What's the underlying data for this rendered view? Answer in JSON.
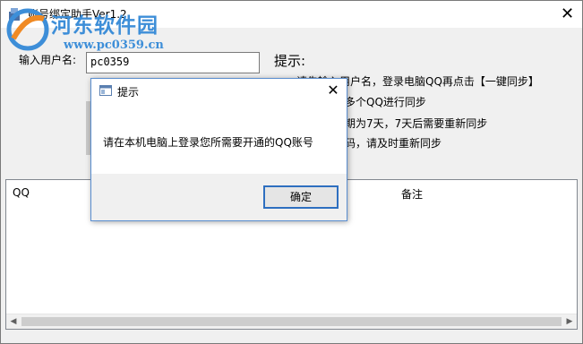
{
  "window": {
    "title": "账号绑定助手Ver1.2",
    "close_glyph": "✕"
  },
  "watermark": {
    "text": "河东软件园",
    "url": "www.pc0359.cn"
  },
  "form": {
    "username_label": "输入用户名:",
    "username_value": "pc0359"
  },
  "tips": {
    "title": "提示:",
    "line1": "请先输入用户名，登录电脑QQ再点击【一键同步】",
    "line2": "多个QQ进行同步",
    "line3": "期为7天，7天后需要重新同步",
    "line4": "码，请及时重新同步"
  },
  "list": {
    "columns": [
      "QQ",
      "备注"
    ]
  },
  "dialog": {
    "title": "提示",
    "message": "请在本机电脑上登录您所需要开通的QQ账号",
    "ok_label": "确定",
    "close_glyph": "✕"
  },
  "colors": {
    "accent": "#2e6fc0",
    "watermark": "#3d8ed8"
  }
}
